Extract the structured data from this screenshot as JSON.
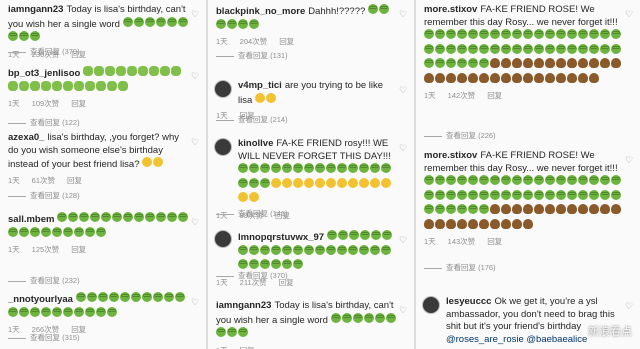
{
  "labels": {
    "reply": "回复",
    "see_replies_prefix": "查看回复"
  },
  "col1": [
    {
      "user": "iamngann23",
      "text": "Today is lisa's birthday, can't you wish her a single word",
      "emojis": [
        "nau",
        "nau",
        "nau",
        "nau",
        "nau",
        "nau",
        "nau",
        "nau",
        "nau"
      ],
      "time": "1天",
      "likes": "236次赞",
      "replies": "(370)"
    },
    {
      "user": "bp_ot3_jenlisoo",
      "text": "",
      "emojis": [
        "frog",
        "frog",
        "frog",
        "frog",
        "frog",
        "frog",
        "frog",
        "frog",
        "frog",
        "frog",
        "frog",
        "frog",
        "frog",
        "frog",
        "frog",
        "frog",
        "frog",
        "frog",
        "frog",
        "frog"
      ],
      "time": "1天",
      "likes": "109次赞",
      "replies": "(122)"
    },
    {
      "user": "azexa0_",
      "text": "lisa's birthday, ,you forget?  why do you wish someone else's birthday instead of your best friend lisa?",
      "emojis": [
        "joy",
        "joy"
      ],
      "time": "1天",
      "likes": "61次赞",
      "replies": "(128)"
    },
    {
      "user": "sall.mbem",
      "text": "",
      "emojis": [
        "nau",
        "nau",
        "nau",
        "nau",
        "nau",
        "nau",
        "nau",
        "nau",
        "nau",
        "nau",
        "nau",
        "nau",
        "nau",
        "nau",
        "nau",
        "nau",
        "nau",
        "nau",
        "nau",
        "nau",
        "nau"
      ],
      "time": "1天",
      "likes": "125次赞",
      "replies": "(232)"
    },
    {
      "user": "_nnotyourlyaa",
      "text": "",
      "emojis": [
        "nau",
        "nau",
        "nau",
        "nau",
        "nau",
        "nau",
        "nau",
        "nau",
        "nau",
        "nau",
        "nau",
        "nau",
        "nau",
        "nau",
        "nau",
        "nau",
        "nau",
        "nau",
        "nau",
        "nau"
      ],
      "time": "1天",
      "likes": "266次赞",
      "replies": "(315)"
    }
  ],
  "col2": [
    {
      "user": "blackpink_no_more",
      "text": "Dahhh!?????",
      "emojis": [
        "nau",
        "nau",
        "nau",
        "nau",
        "nau",
        "nau"
      ],
      "time": "1天",
      "likes": "204次赞",
      "replies": "(131)"
    },
    {
      "user": "v4mp_tici",
      "text": "are you trying to be like lisa",
      "emojis": [
        "joy",
        "joy"
      ],
      "time": "1天",
      "likes": "",
      "replies": "(214)"
    },
    {
      "user": "kinollve",
      "text": "FA-KE FRIEND rosy!!! WE WILL NEVER FORGET THIS DAY!!!",
      "emojis": [
        "nau",
        "nau",
        "nau",
        "nau",
        "nau",
        "nau",
        "nau",
        "nau",
        "nau",
        "nau",
        "nau",
        "nau",
        "nau",
        "nau",
        "nau",
        "nau",
        "nau",
        "joy",
        "joy",
        "joy",
        "joy",
        "joy",
        "joy",
        "joy",
        "joy",
        "joy",
        "joy",
        "joy",
        "joy",
        "joy"
      ],
      "time": "1天",
      "likes": "99次赞",
      "replies": "(141)"
    },
    {
      "user": "lmnopqrstuvwx_97",
      "text": "",
      "emojis": [
        "nau",
        "nau",
        "nau",
        "nau",
        "nau",
        "nau",
        "nau",
        "nau",
        "nau",
        "nau",
        "nau",
        "nau",
        "nau",
        "nau",
        "nau",
        "nau",
        "nau",
        "nau",
        "nau",
        "nau",
        "nau",
        "nau",
        "nau",
        "nau",
        "nau",
        "nau"
      ],
      "time": "1天",
      "likes": "211次赞",
      "replies": "(370)"
    },
    {
      "user": "iamngann23",
      "text": "Today is lisa's birthday, can't you wish her a single word",
      "emojis": [
        "nau",
        "nau",
        "nau",
        "nau",
        "nau",
        "nau",
        "nau",
        "nau",
        "nau"
      ],
      "time": "1天",
      "likes": "",
      "replies": ""
    }
  ],
  "col3": [
    {
      "user": "more.stixov",
      "text": "FA-KE FRIEND ROSE! We remember this day Rosy... we never forget it!!!",
      "emojis": [
        "nau",
        "nau",
        "nau",
        "nau",
        "nau",
        "nau",
        "nau",
        "nau",
        "nau",
        "nau",
        "nau",
        "nau",
        "nau",
        "nau",
        "nau",
        "nau",
        "nau",
        "nau",
        "nau",
        "nau",
        "nau",
        "nau",
        "nau",
        "nau",
        "nau",
        "nau",
        "nau",
        "nau",
        "nau",
        "nau",
        "nau",
        "nau",
        "nau",
        "nau",
        "nau",
        "nau",
        "nau",
        "nau",
        "nau",
        "nau",
        "nau",
        "nau",
        "poo",
        "poo",
        "poo",
        "poo",
        "poo",
        "poo",
        "poo",
        "poo",
        "poo",
        "poo",
        "poo",
        "poo",
        "poo",
        "poo",
        "poo",
        "poo",
        "poo",
        "poo",
        "poo",
        "poo",
        "poo",
        "poo",
        "poo",
        "poo",
        "poo",
        "poo",
        "poo",
        "poo"
      ],
      "time": "1天",
      "likes": "142次赞",
      "replies": "(226)"
    },
    {
      "user": "more.stixov",
      "text": "FA-KE FRIEND ROSE! We remember this day Rosy... we never forget it!!!",
      "emojis": [
        "nau",
        "nau",
        "nau",
        "nau",
        "nau",
        "nau",
        "nau",
        "nau",
        "nau",
        "nau",
        "nau",
        "nau",
        "nau",
        "nau",
        "nau",
        "nau",
        "nau",
        "nau",
        "nau",
        "nau",
        "nau",
        "nau",
        "nau",
        "nau",
        "nau",
        "nau",
        "nau",
        "nau",
        "nau",
        "nau",
        "nau",
        "nau",
        "nau",
        "nau",
        "nau",
        "nau",
        "nau",
        "nau",
        "nau",
        "nau",
        "nau",
        "nau",
        "poo",
        "poo",
        "poo",
        "poo",
        "poo",
        "poo",
        "poo",
        "poo",
        "poo",
        "poo",
        "poo",
        "poo",
        "poo",
        "poo",
        "poo",
        "poo",
        "poo",
        "poo",
        "poo",
        "poo",
        "poo",
        "poo"
      ],
      "time": "1天",
      "likes": "143次赞",
      "replies": "(176)"
    },
    {
      "user": "lesyeuccc",
      "text": "Ok we get it, you're a ysl ambassador, you don't need to brag this shit but it's your friend's birthday",
      "mentions": "@roses_are_rosie @baebaealice",
      "emojis": [],
      "time": "",
      "likes": "",
      "replies": ""
    }
  ],
  "watermark": "新浪看点"
}
